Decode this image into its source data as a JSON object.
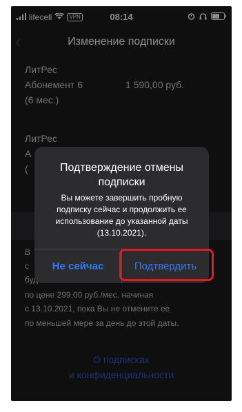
{
  "statusbar": {
    "carrier": "lifecell",
    "vpn": "VPN",
    "time": "08:14"
  },
  "nav": {
    "title": "Изменение подписки"
  },
  "subscriptions": [
    {
      "provider": "ЛитРес",
      "plan": "Абонемент 6",
      "period": "(6 мес.)",
      "price": "1 590,00 руб."
    },
    {
      "provider": "ЛитРес",
      "plan": "А",
      "period": "(",
      "price": ""
    }
  ],
  "footnote": {
    "lines": [
      "В",
      "с",
      "будет возобновляться",
      "по цене 299,00 руб./мес. начиная",
      "с 13.10.2021, пока Вы не отмените ее",
      "по меньшей мере за день до этой даты."
    ]
  },
  "privacy_link": {
    "line1": "О подписках",
    "line2": "и конфиденциальности"
  },
  "alert": {
    "title": "Подтверждение отмены подписки",
    "message": "Вы можете завершить пробную подписку сейчас и продолжить ее использование до указанной даты (13.10.2021).",
    "cancel_label": "Не сейчас",
    "confirm_label": "Подтвердить"
  },
  "colors": {
    "accent": "#2f7cf6",
    "highlight": "#e8191e",
    "link": "#2a5fd9"
  }
}
